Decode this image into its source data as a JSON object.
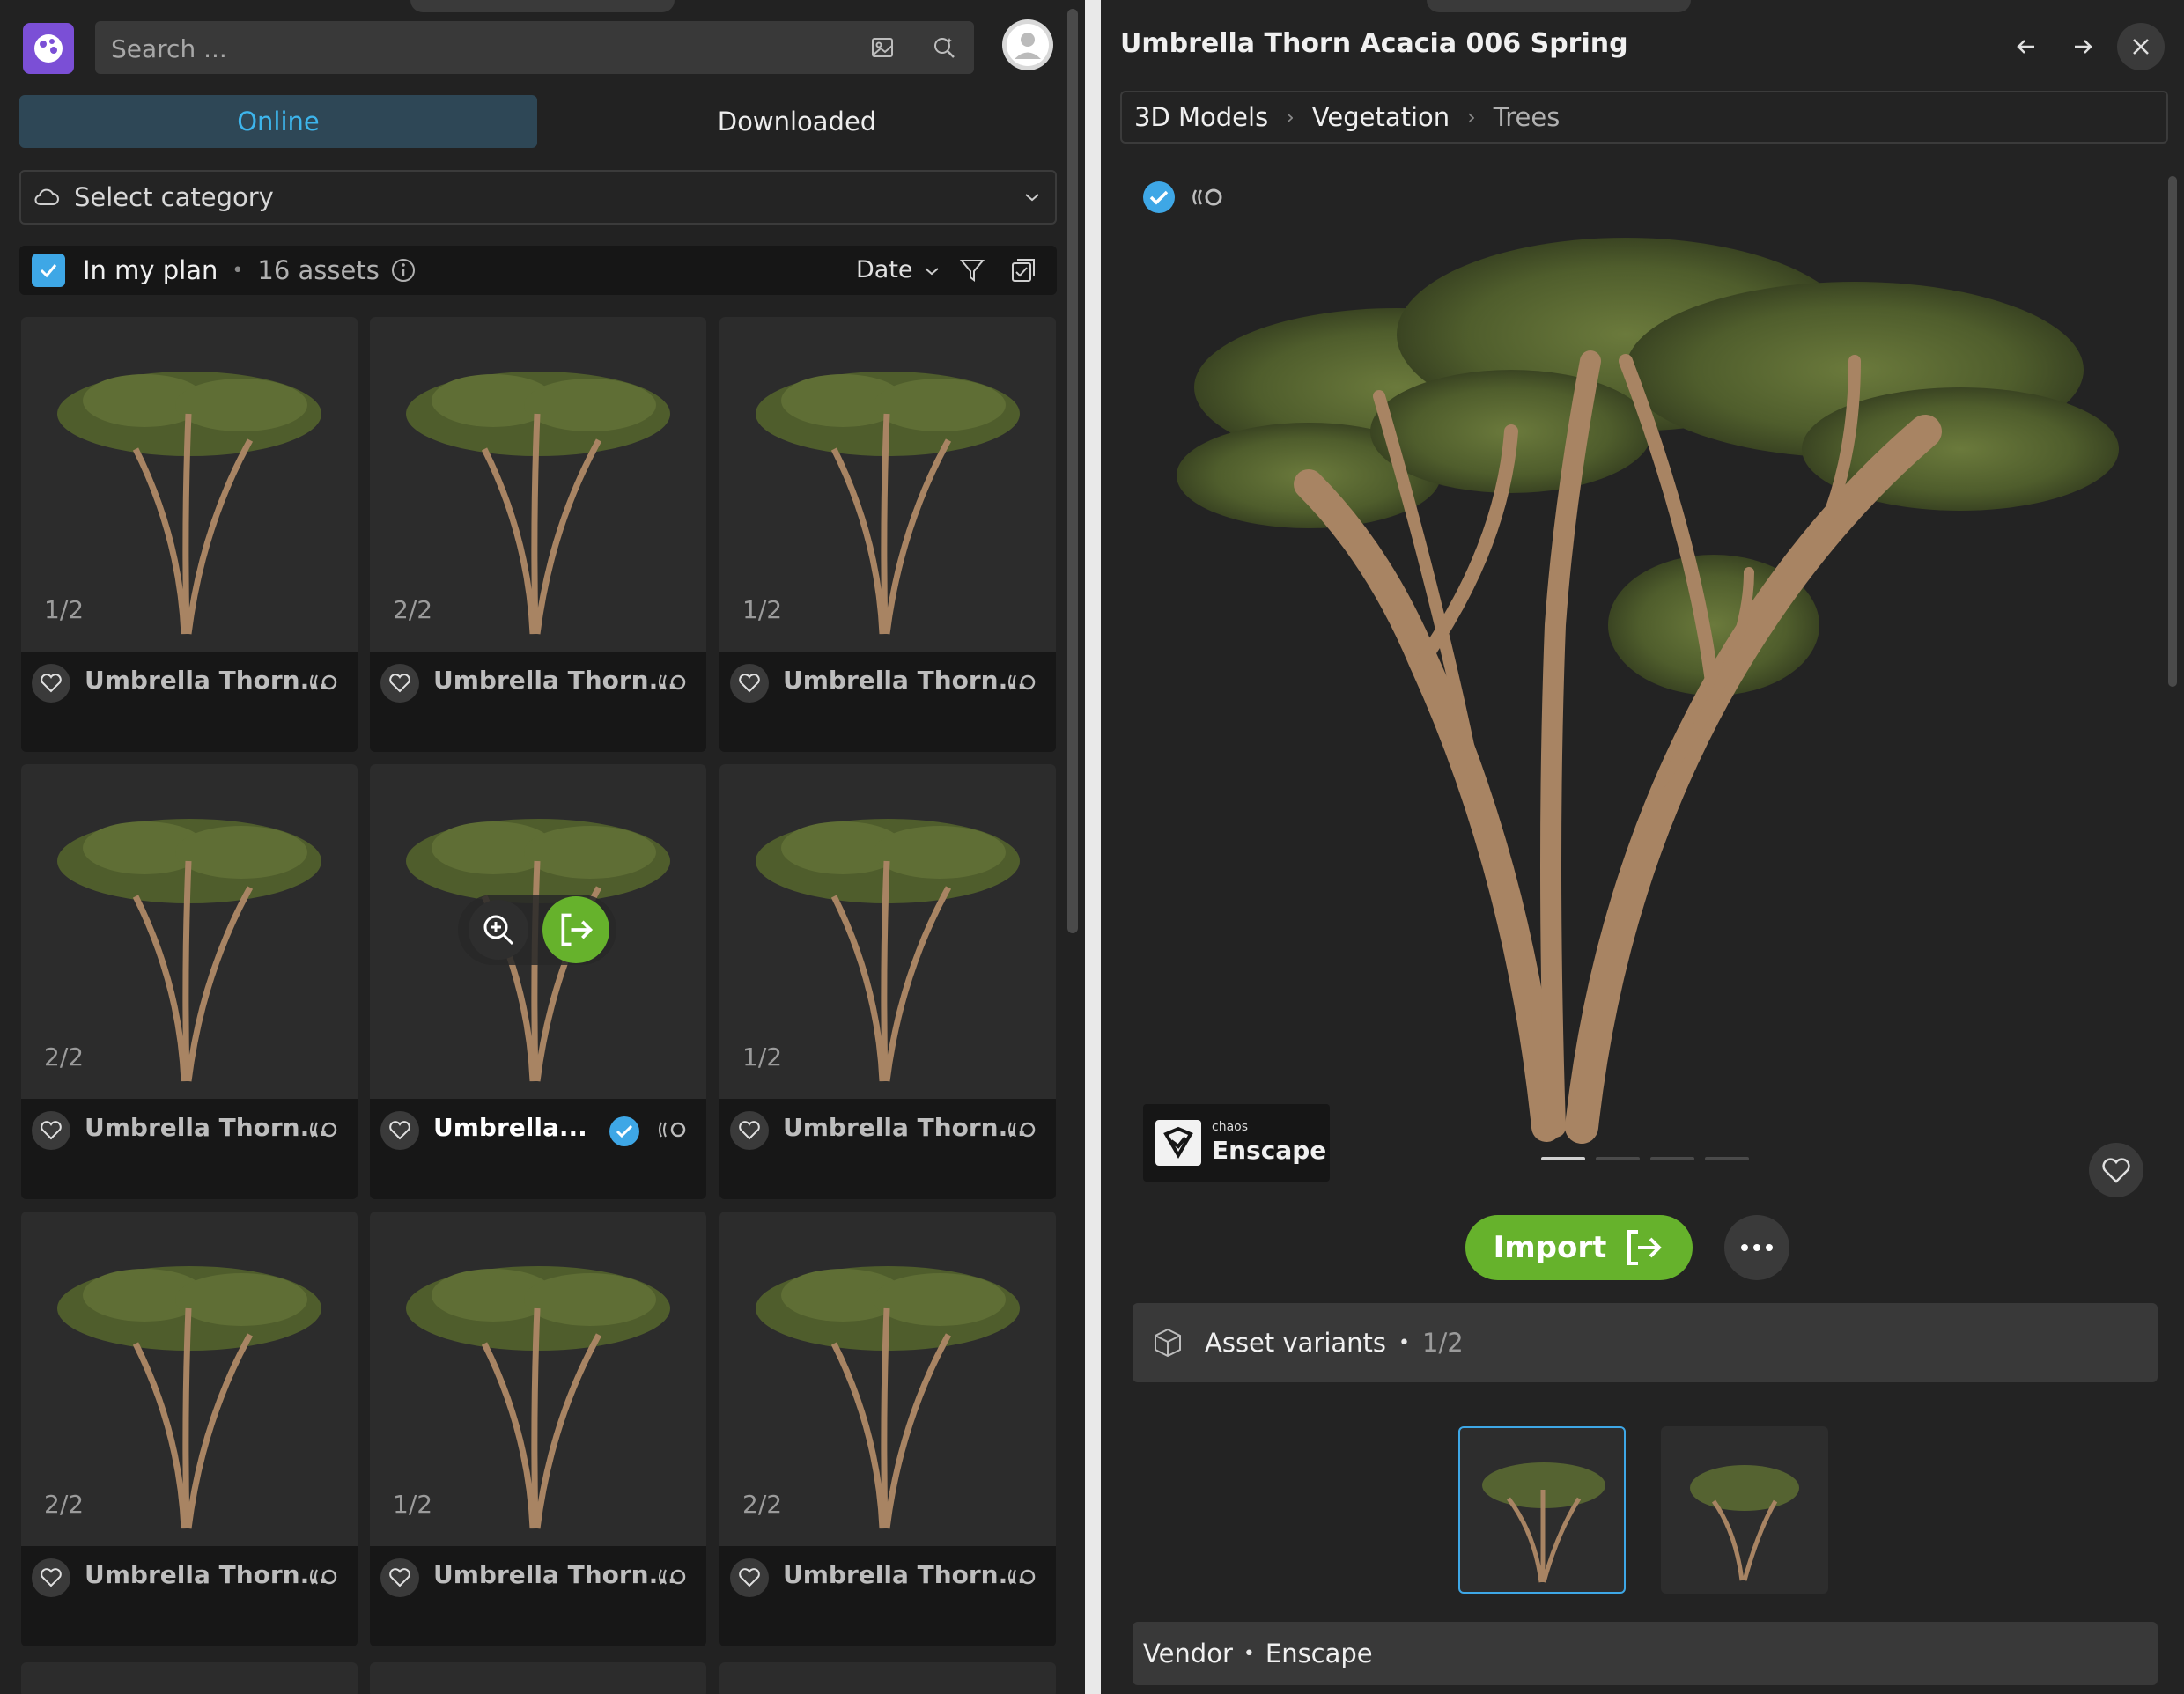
{
  "search": {
    "placeholder": "Search ..."
  },
  "tabs": {
    "online": "Online",
    "downloaded": "Downloaded"
  },
  "category": {
    "placeholder": "Select category"
  },
  "plan": {
    "label": "In my plan",
    "count": "16 assets",
    "sort": "Date"
  },
  "grid": {
    "cards": [
      {
        "count": "1/2",
        "name": "Umbrella Thorn..."
      },
      {
        "count": "2/2",
        "name": "Umbrella Thorn..."
      },
      {
        "count": "1/2",
        "name": "Umbrella Thorn..."
      },
      {
        "count": "2/2",
        "name": "Umbrella Thorn..."
      },
      {
        "count": "",
        "name": "Umbrella..."
      },
      {
        "count": "1/2",
        "name": "Umbrella Thorn..."
      },
      {
        "count": "2/2",
        "name": "Umbrella Thorn..."
      },
      {
        "count": "1/2",
        "name": "Umbrella Thorn..."
      },
      {
        "count": "2/2",
        "name": "Umbrella Thorn..."
      }
    ]
  },
  "detail": {
    "title": "Umbrella Thorn Acacia 006 Spring",
    "breadcrumbs": [
      "3D Models",
      "Vegetation",
      "Trees"
    ],
    "badge_small": "chaos",
    "badge_big": "Enscape",
    "import_label": "Import",
    "variants_label": "Asset variants",
    "variants_count": "1/2",
    "vendor_label": "Vendor",
    "vendor_value": "Enscape"
  },
  "colors": {
    "accent": "#3db5ec",
    "import": "#66b22c",
    "brand": "#7b4fd6"
  }
}
